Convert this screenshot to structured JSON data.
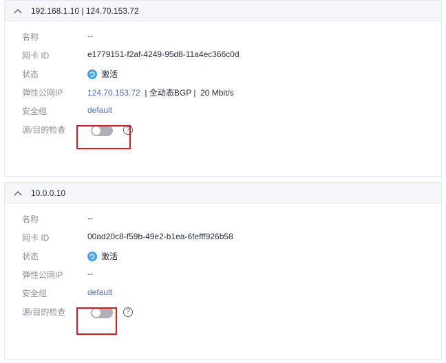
{
  "panels": [
    {
      "header": "192.168.1.10 | 124.70.153.72",
      "labels": {
        "name": "名称",
        "nic_id": "网卡 ID",
        "status": "状态",
        "eip": "弹性公网IP",
        "security_group": "安全组",
        "src_dst_check": "源/目的检查"
      },
      "values": {
        "name": "--",
        "nic_id": "e1779151-f2af-4249-95d8-11a4ec366c0d",
        "status": "激活",
        "eip_address": "124.70.153.72",
        "eip_suffix": "  | 全动态BGP |  20 Mbit/s",
        "security_group": "default",
        "src_dst_check_enabled": false
      }
    },
    {
      "header": "10.0.0.10",
      "labels": {
        "name": "名称",
        "nic_id": "网卡 ID",
        "status": "状态",
        "eip": "弹性公网IP",
        "security_group": "安全组",
        "src_dst_check": "源/目的检查"
      },
      "values": {
        "name": "--",
        "nic_id": "00ad20c8-f59b-49e2-b1ea-6fefff926b58",
        "status": "激活",
        "eip": "--",
        "security_group": "default",
        "src_dst_check_enabled": false
      }
    }
  ],
  "icons": {
    "collapse": "chevron-up-icon",
    "status": "status-active-icon",
    "help": "help-circle-icon"
  },
  "help_glyph": "?",
  "colors": {
    "link": "#526ecc",
    "label": "#8a8e99",
    "header_bg": "#f4f6f9",
    "status_icon": "#3ca4f0",
    "toggle_off": "#adb0b8",
    "highlight_box": "#e5161b"
  }
}
